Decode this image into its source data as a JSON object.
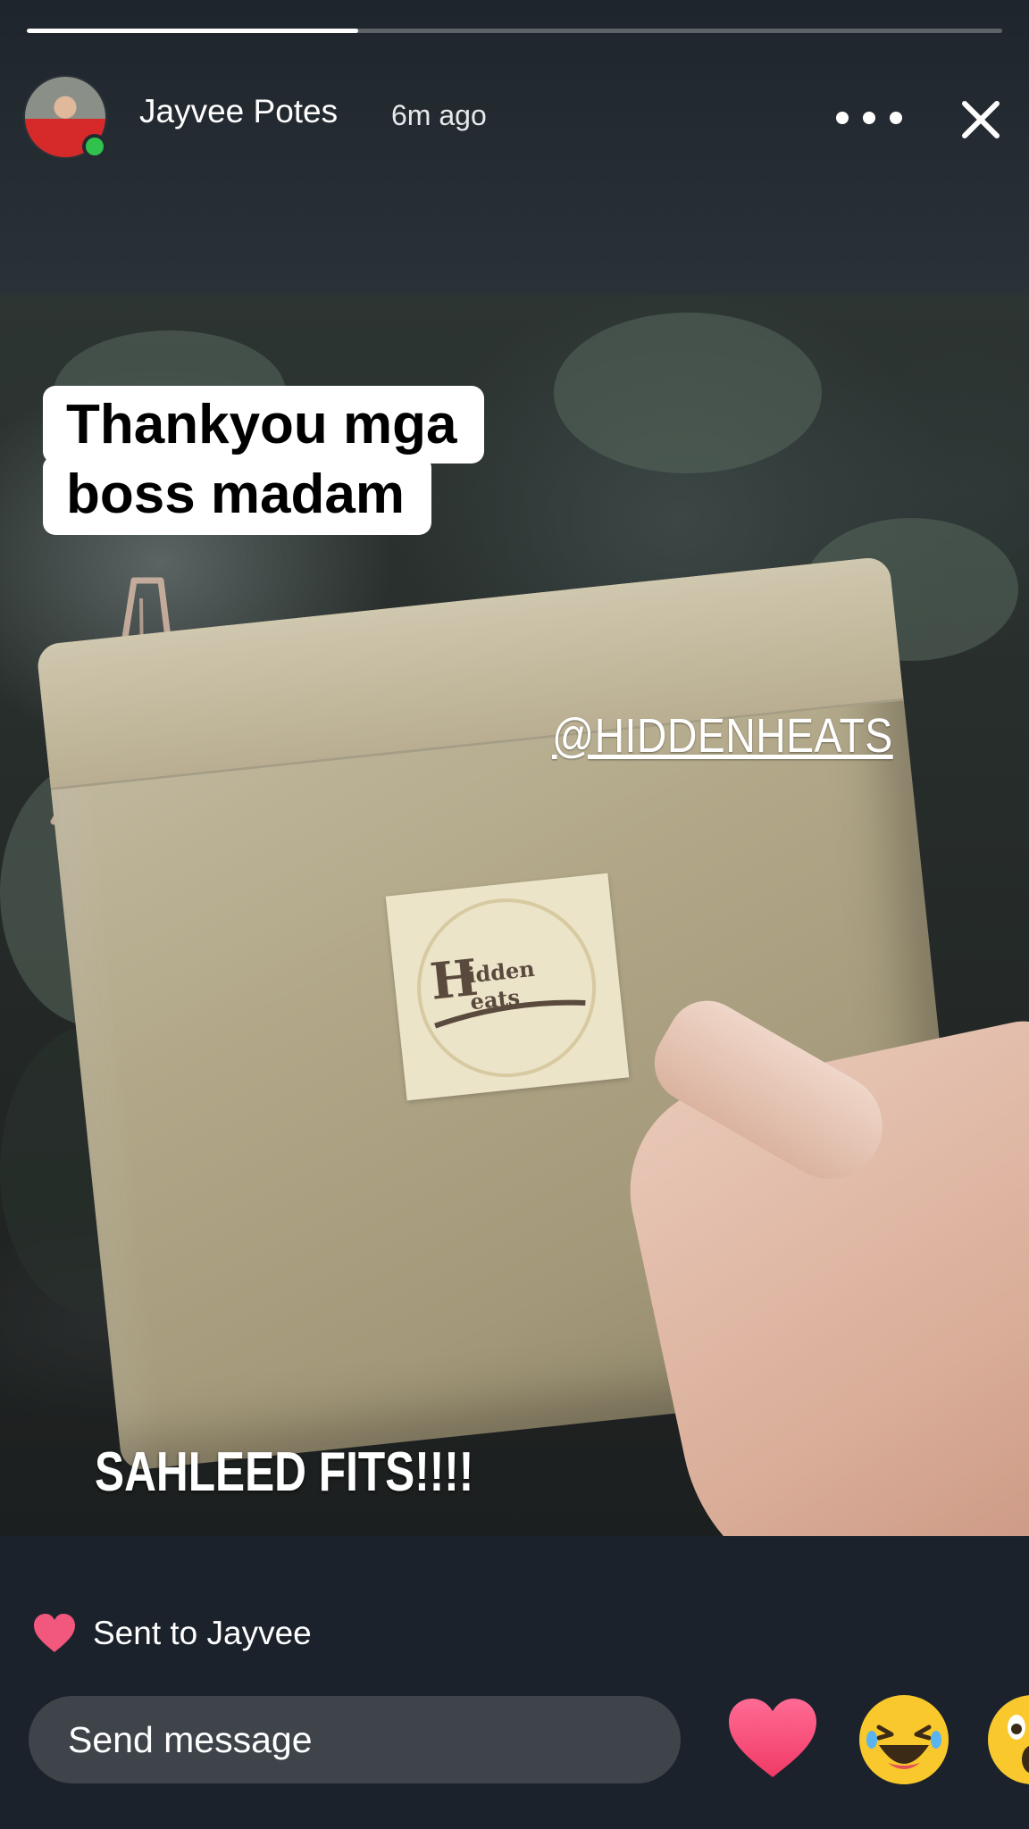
{
  "story": {
    "progress_fraction": 0.34,
    "author_name": "Jayvee Potes",
    "time_ago": "6m ago"
  },
  "media": {
    "caption_line1": "Thankyou  mga",
    "caption_line2": "boss madam",
    "mention": "@HIDDENHEATS",
    "overlay_text": "SAHLEED FITS!!!!"
  },
  "footer": {
    "sent_text": "Sent to Jayvee",
    "message_placeholder": "Send message"
  },
  "icons": {
    "more": "more-icon",
    "close": "close-icon",
    "sent_heart": "heart-icon",
    "reactions": [
      "heart-icon",
      "laughing-emoji-icon",
      "wow-emoji-icon"
    ]
  },
  "colors": {
    "background": "#1b222b",
    "online": "#31c24d",
    "heart": "#f2577d",
    "input_bg": "#3e444a"
  }
}
